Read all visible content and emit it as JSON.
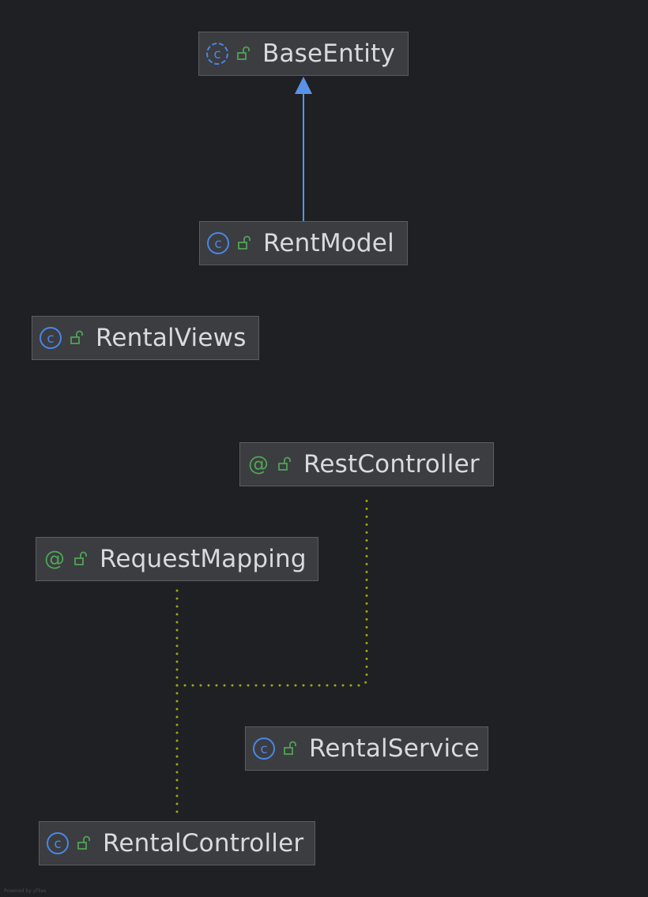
{
  "colors": {
    "background": "#1f2024",
    "node_fill": "#3c3d40",
    "node_border": "#5b5d62",
    "node_text": "#d9dadd",
    "class_icon": "#4a86e8",
    "annotation_icon": "#4fa356",
    "visibility_icon": "#4fa356",
    "inheritance_edge": "#5a93e6",
    "annotation_edge": "#9fa70e"
  },
  "diagram": {
    "nodes": [
      {
        "id": "base-entity",
        "label": "BaseEntity",
        "kind": "abstract-class",
        "icon": "abstract-class-icon"
      },
      {
        "id": "rent-model",
        "label": "RentModel",
        "kind": "class",
        "icon": "class-icon"
      },
      {
        "id": "rental-views",
        "label": "RentalViews",
        "kind": "class",
        "icon": "class-icon"
      },
      {
        "id": "rest-controller",
        "label": "RestController",
        "kind": "annotation",
        "icon": "annotation-icon"
      },
      {
        "id": "request-mapping",
        "label": "RequestMapping",
        "kind": "annotation",
        "icon": "annotation-icon"
      },
      {
        "id": "rental-service",
        "label": "RentalService",
        "kind": "class",
        "icon": "class-icon"
      },
      {
        "id": "rental-controller",
        "label": "RentalController",
        "kind": "class",
        "icon": "class-icon"
      }
    ],
    "edges": [
      {
        "from": "rent-model",
        "to": "base-entity",
        "type": "inheritance"
      },
      {
        "from": "rental-controller",
        "to": "request-mapping",
        "type": "annotated-with"
      },
      {
        "from": "rental-controller",
        "to": "rest-controller",
        "type": "annotated-with"
      }
    ],
    "footer": "Powered by yFiles"
  }
}
